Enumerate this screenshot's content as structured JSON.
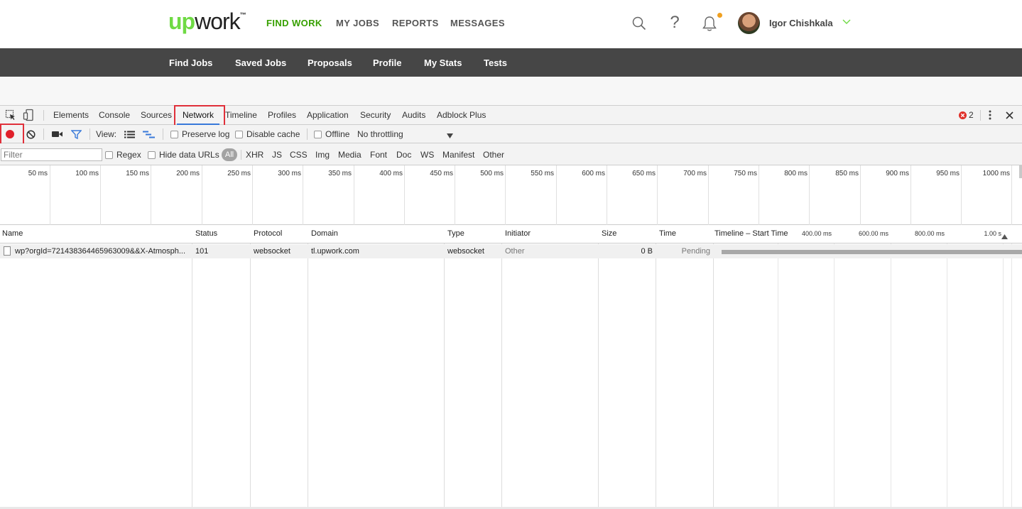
{
  "upwork": {
    "logo_up": "up",
    "logo_work": "work",
    "logo_tm": "™",
    "nav": [
      "FIND WORK",
      "MY JOBS",
      "REPORTS",
      "MESSAGES"
    ],
    "nav_active_color": "#37a000",
    "help_glyph": "?",
    "user_name": "Igor Chishkala",
    "subnav": [
      "Find Jobs",
      "Saved Jobs",
      "Proposals",
      "Profile",
      "My Stats",
      "Tests"
    ]
  },
  "devtools": {
    "tabs": [
      "Elements",
      "Console",
      "Sources",
      "Network",
      "Timeline",
      "Profiles",
      "Application",
      "Security",
      "Audits",
      "Adblock Plus"
    ],
    "active_tab": "Network",
    "error_count": "2",
    "toolbar": {
      "view_label": "View:",
      "preserve_log": "Preserve log",
      "disable_cache": "Disable cache",
      "offline": "Offline",
      "throttling": "No throttling"
    },
    "filter": {
      "placeholder": "Filter",
      "regex": "Regex",
      "hide_data_urls": "Hide data URLs",
      "types": [
        "All",
        "XHR",
        "JS",
        "CSS",
        "Img",
        "Media",
        "Font",
        "Doc",
        "WS",
        "Manifest",
        "Other"
      ]
    },
    "overview_ticks": [
      "50 ms",
      "100 ms",
      "150 ms",
      "200 ms",
      "250 ms",
      "300 ms",
      "350 ms",
      "400 ms",
      "450 ms",
      "500 ms",
      "550 ms",
      "600 ms",
      "650 ms",
      "700 ms",
      "750 ms",
      "800 ms",
      "850 ms",
      "900 ms",
      "950 ms",
      "1000 ms"
    ],
    "columns": [
      "Name",
      "Status",
      "Protocol",
      "Domain",
      "Type",
      "Initiator",
      "Size",
      "Time",
      "Timeline – Start Time"
    ],
    "timeline_ticks": [
      "400.00 ms",
      "600.00 ms",
      "800.00 ms",
      "1.00 s"
    ],
    "rows": [
      {
        "name": "wp?orgId=721438364465963009&&X-Atmosph...",
        "status": "101",
        "protocol": "websocket",
        "domain": "tl.upwork.com",
        "type": "websocket",
        "initiator": "Other",
        "size": "0 B",
        "time": "Pending"
      }
    ],
    "record_color": "#e0202a",
    "highlight_color": "#e0303a"
  }
}
